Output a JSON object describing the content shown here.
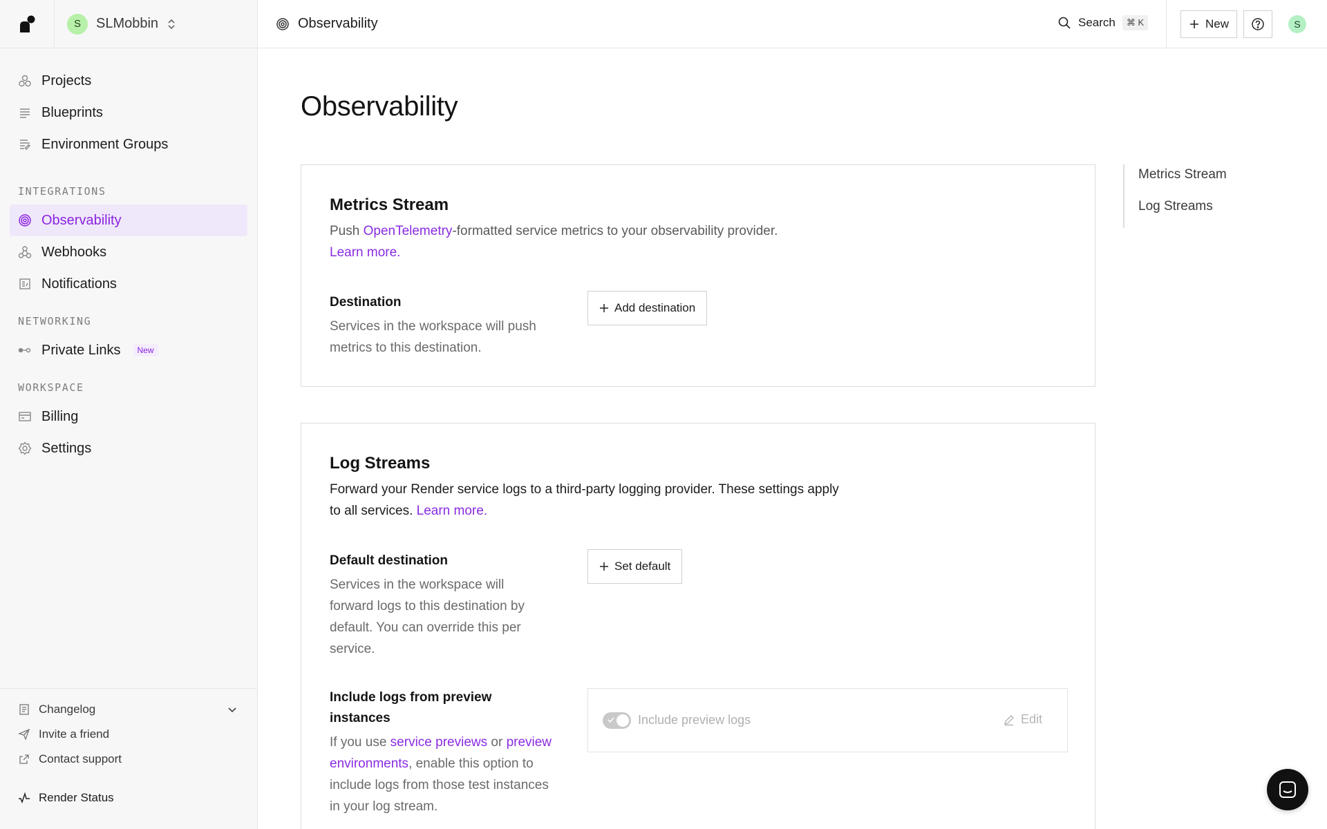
{
  "workspace": {
    "avatar_letter": "S",
    "name": "SLMobbin"
  },
  "sidebar": {
    "nav": [
      {
        "label": "Projects",
        "icon": "projects-icon"
      },
      {
        "label": "Blueprints",
        "icon": "blueprints-icon"
      },
      {
        "label": "Environment Groups",
        "icon": "environment-groups-icon"
      }
    ],
    "sections": {
      "integrations": "INTEGRATIONS",
      "networking": "NETWORKING",
      "workspace": "WORKSPACE"
    },
    "integrations": [
      {
        "label": "Observability",
        "icon": "observability-icon",
        "active": true
      },
      {
        "label": "Webhooks",
        "icon": "webhooks-icon"
      },
      {
        "label": "Notifications",
        "icon": "notifications-icon"
      }
    ],
    "networking": [
      {
        "label": "Private Links",
        "icon": "private-links-icon",
        "badge": "New"
      }
    ],
    "workspace_items": [
      {
        "label": "Billing",
        "icon": "billing-icon"
      },
      {
        "label": "Settings",
        "icon": "settings-icon"
      }
    ],
    "footer": {
      "changelog": "Changelog",
      "invite": "Invite a friend",
      "support": "Contact support",
      "status": "Render Status"
    }
  },
  "topbar": {
    "breadcrumb": "Observability",
    "search_label": "Search",
    "search_shortcut": "⌘ K",
    "new_label": "New",
    "user_avatar": "S"
  },
  "page": {
    "title": "Observability",
    "metrics": {
      "title": "Metrics Stream",
      "desc_prefix": "Push ",
      "desc_link": "OpenTelemetry",
      "desc_suffix": "-formatted service metrics to your observability provider.",
      "learn_more": "Learn more.",
      "destination_label": "Destination",
      "destination_help": "Services in the workspace will push metrics to this destination.",
      "add_destination": "Add destination"
    },
    "logs": {
      "title": "Log Streams",
      "desc": "Forward your Render service logs to a third-party logging provider. These settings apply to all services.",
      "learn_more": "Learn more.",
      "default_label": "Default destination",
      "default_help": "Services in the workspace will forward logs to this destination by default. You can override this per service.",
      "set_default": "Set default",
      "preview_label": "Include logs from preview instances",
      "preview_help_1": "If you use ",
      "preview_link_1": "service previews",
      "preview_help_2": " or ",
      "preview_link_2": "preview environments",
      "preview_help_3": ", enable this option to include logs from those test instances in your log stream.",
      "toggle_label": "Include preview logs",
      "toggle_on": true,
      "edit_label": "Edit"
    }
  },
  "toc": [
    "Metrics Stream",
    "Log Streams"
  ],
  "colors": {
    "accent": "#8b22e0",
    "active_bg": "#efe8fb",
    "sidebar_bg": "#f7f7f7",
    "border": "#e6e6e6"
  }
}
